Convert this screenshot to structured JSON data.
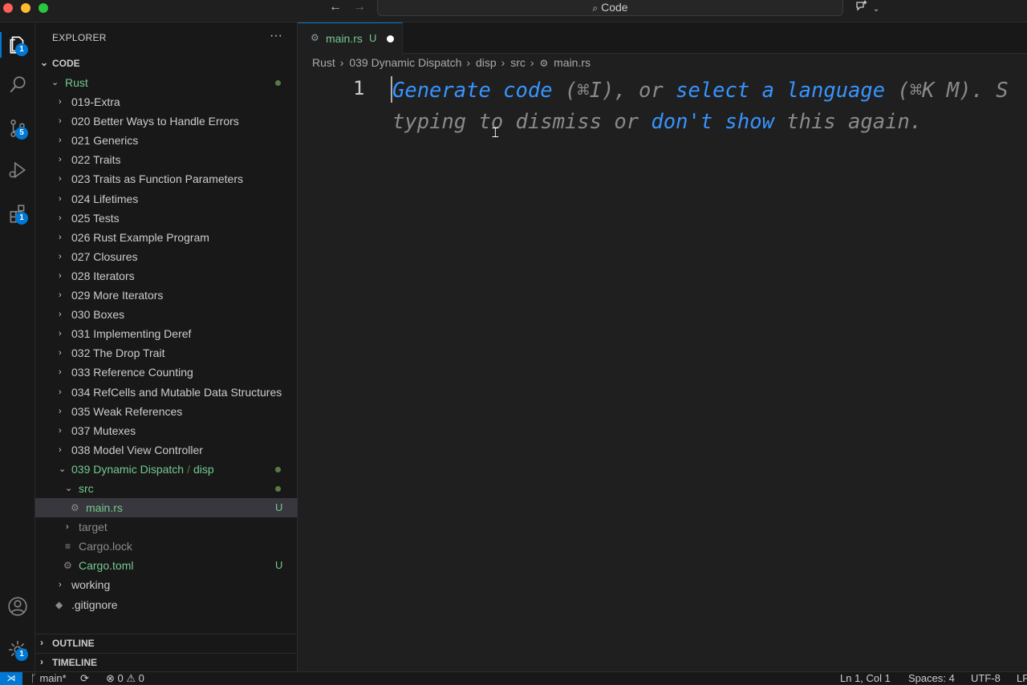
{
  "titlebar": {
    "command_center_label": "Code",
    "back_icon": "arrow-left-icon",
    "forward_icon": "arrow-right-icon"
  },
  "activitybar": {
    "explorer_badge": "1",
    "scm_badge": "5",
    "extensions_badge": "1",
    "settings_badge": "1"
  },
  "sidebar": {
    "title": "EXPLORER",
    "more_label": "···",
    "workspace_label": "CODE",
    "root_folder": "Rust",
    "folders": [
      "019-Extra",
      "020 Better Ways to Handle Errors",
      "021 Generics",
      "022 Traits",
      "023 Traits as Function Parameters",
      "024 Lifetimes",
      "025 Tests",
      "026 Rust Example Program",
      "027 Closures",
      "028 Iterators",
      "029 More Iterators",
      "030 Boxes",
      "031 Implementing Deref",
      "032 The Drop Trait",
      "033 Reference Counting",
      "034 RefCells and Mutable Data Structures",
      "035 Weak References",
      "037 Mutexes",
      "038 Model View Controller"
    ],
    "open_folder": "039 Dynamic Dispatch",
    "open_subfolder": "disp",
    "src_folder": "src",
    "main_file": "main.rs",
    "main_status": "U",
    "target_folder": "target",
    "cargo_lock": "Cargo.lock",
    "cargo_toml": "Cargo.toml",
    "cargo_toml_status": "U",
    "working_folder": "working",
    "gitignore": ".gitignore",
    "outline_label": "OUTLINE",
    "timeline_label": "TIMELINE"
  },
  "editor": {
    "tab_label": "main.rs",
    "tab_status": "U",
    "breadcrumb": [
      "Rust",
      "039 Dynamic Dispatch",
      "disp",
      "src",
      "main.rs"
    ],
    "line_number": "1",
    "hint": {
      "generate_code": "Generate code",
      "generate_shortcut": " (⌘I), or ",
      "select_language": "select a language",
      "select_shortcut": " (⌘K M). S",
      "line2_prefix": "typing to dismiss or ",
      "dont_show": "don't show",
      "line2_suffix": " this again."
    }
  },
  "statusbar": {
    "branch": "main*",
    "errors": "0",
    "warnings": "0",
    "cursor_position": "Ln 1, Col 1",
    "indentation": "Spaces: 4",
    "encoding": "UTF-8",
    "eol": "LF"
  },
  "colors": {
    "accent": "#0078d4",
    "untracked_green": "#73c991",
    "link_blue": "#3794ff"
  }
}
